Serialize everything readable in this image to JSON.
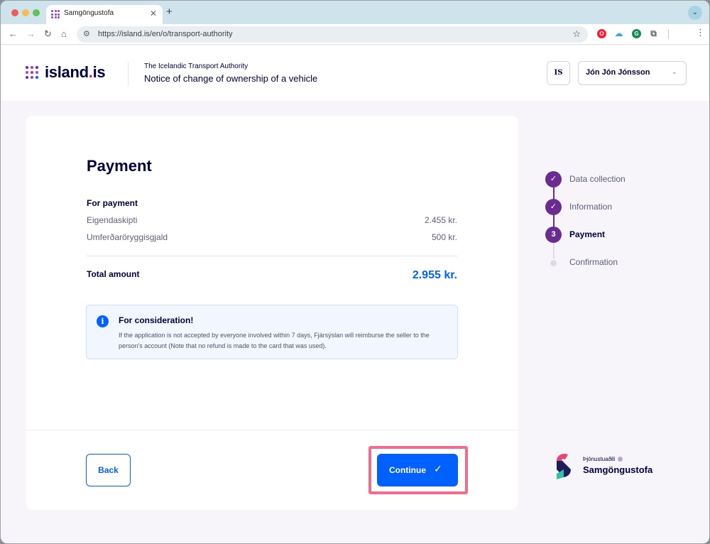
{
  "browser": {
    "tab_title": "Samgöngustofa",
    "tab_close": "✕",
    "new_tab": "+",
    "url": "https://island.is/en/o/transport-authority"
  },
  "header": {
    "logo_main": "island",
    "logo_dot": ".",
    "logo_suffix": "is",
    "organization": "The Icelandic Transport Authority",
    "form_title": "Notice of change of ownership of a vehicle",
    "language_button": "IS",
    "user_name": "Jón Jón Jónsson"
  },
  "payment": {
    "title": "Payment",
    "section_label": "For payment",
    "items": [
      {
        "label": "Eigendaskipti",
        "amount": "2.455 kr."
      },
      {
        "label": "Umferðaröryggisgjald",
        "amount": "500 kr."
      }
    ],
    "total_label": "Total amount",
    "total_amount": "2.955 kr."
  },
  "alert": {
    "icon": "i",
    "title": "For consideration!",
    "text": "If the application is not accepted by everyone involved within 7 days, Fjársýslan will reimburse the seller to the person's account (Note that no refund is made to the card that was used)."
  },
  "actions": {
    "back_label": "Back",
    "continue_label": "Continue",
    "continue_icon": "✓"
  },
  "stepper": {
    "steps": [
      {
        "label": "Data collection",
        "marker": "✓",
        "state": "done"
      },
      {
        "label": "Information",
        "marker": "✓",
        "state": "done"
      },
      {
        "label": "Payment",
        "marker": "3",
        "state": "active"
      },
      {
        "label": "Confirmation",
        "marker": "",
        "state": "upcoming"
      }
    ]
  },
  "service_provider": {
    "caption": "Þjónustuaðili",
    "name": "Samgöngustofa"
  },
  "colors": {
    "primary_blue": "#0061ff",
    "step_purple": "#6a2c91",
    "highlight_pink": "#f36b8d",
    "dark_blue": "#00003c"
  }
}
